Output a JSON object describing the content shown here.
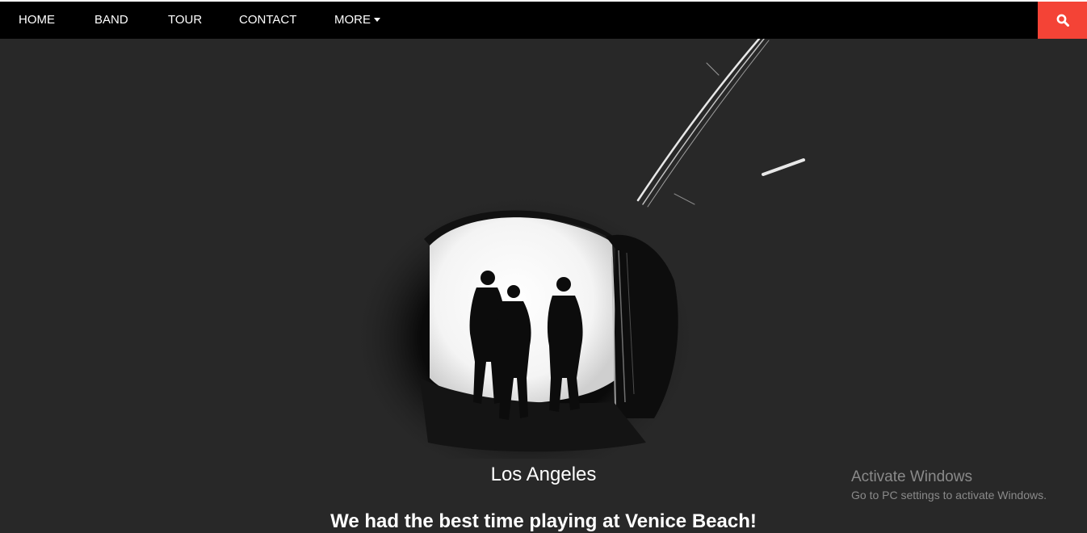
{
  "nav": {
    "items": [
      {
        "label": "HOME"
      },
      {
        "label": "BAND"
      },
      {
        "label": "TOUR"
      },
      {
        "label": "CONTACT"
      },
      {
        "label": "MORE"
      }
    ],
    "search_icon": "search-icon",
    "accent_color": "#f44336"
  },
  "hero": {
    "city": "Los Angeles",
    "text": "We had the best time playing at Venice Beach!"
  },
  "watermark": {
    "title": "Activate Windows",
    "subtitle": "Go to PC settings to activate Windows."
  }
}
